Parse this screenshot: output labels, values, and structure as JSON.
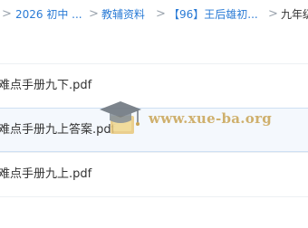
{
  "breadcrumb": {
    "items": [
      {
        "label": "2026 初中 ..."
      },
      {
        "label": "教辅资料"
      },
      {
        "label": "【96】王后雄初..."
      },
      {
        "label": "九年级"
      }
    ]
  },
  "files": [
    {
      "name": "难点手册九下.pdf"
    },
    {
      "name": "难点手册九上答案.pdf"
    },
    {
      "name": "难点手册九上.pdf"
    }
  ],
  "watermark": {
    "text": "www.xue-ba.org",
    "icon": "graduation-cap-icon"
  },
  "colors": {
    "link": "#2a7bd6",
    "separator": "#9aa3ad",
    "selected_row": "#f4f8fd",
    "watermark": "#c9a455"
  }
}
